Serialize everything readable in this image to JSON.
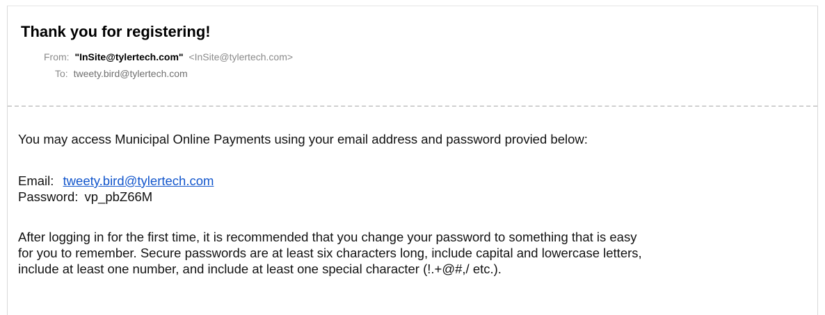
{
  "email": {
    "subject": "Thank you for registering!",
    "from_label": "From:",
    "from_name": "\"InSite@tylertech.com\"",
    "from_address": "<InSite@tylertech.com>",
    "to_label": "To:",
    "to_address": "tweety.bird@tylertech.com",
    "body": {
      "intro": "You may access Municipal Online Payments using your email address and password provied below:",
      "email_label": "Email:",
      "email_value": "tweety.bird@tylertech.com",
      "password_label": "Password:",
      "password_value": "vp_pbZ66M",
      "advice_lines": [
        "After logging in for the first time, it is recommended that you change your password to something that is easy",
        "for you to remember. Secure passwords are at least six characters long, include capital and lowercase letters,",
        "include at least one number, and include at least one special character (!.+@#,/ etc.)."
      ]
    }
  },
  "colors": {
    "link": "#1155cc",
    "meta_text": "#7a7a7a",
    "divider": "#cfcfcf"
  }
}
